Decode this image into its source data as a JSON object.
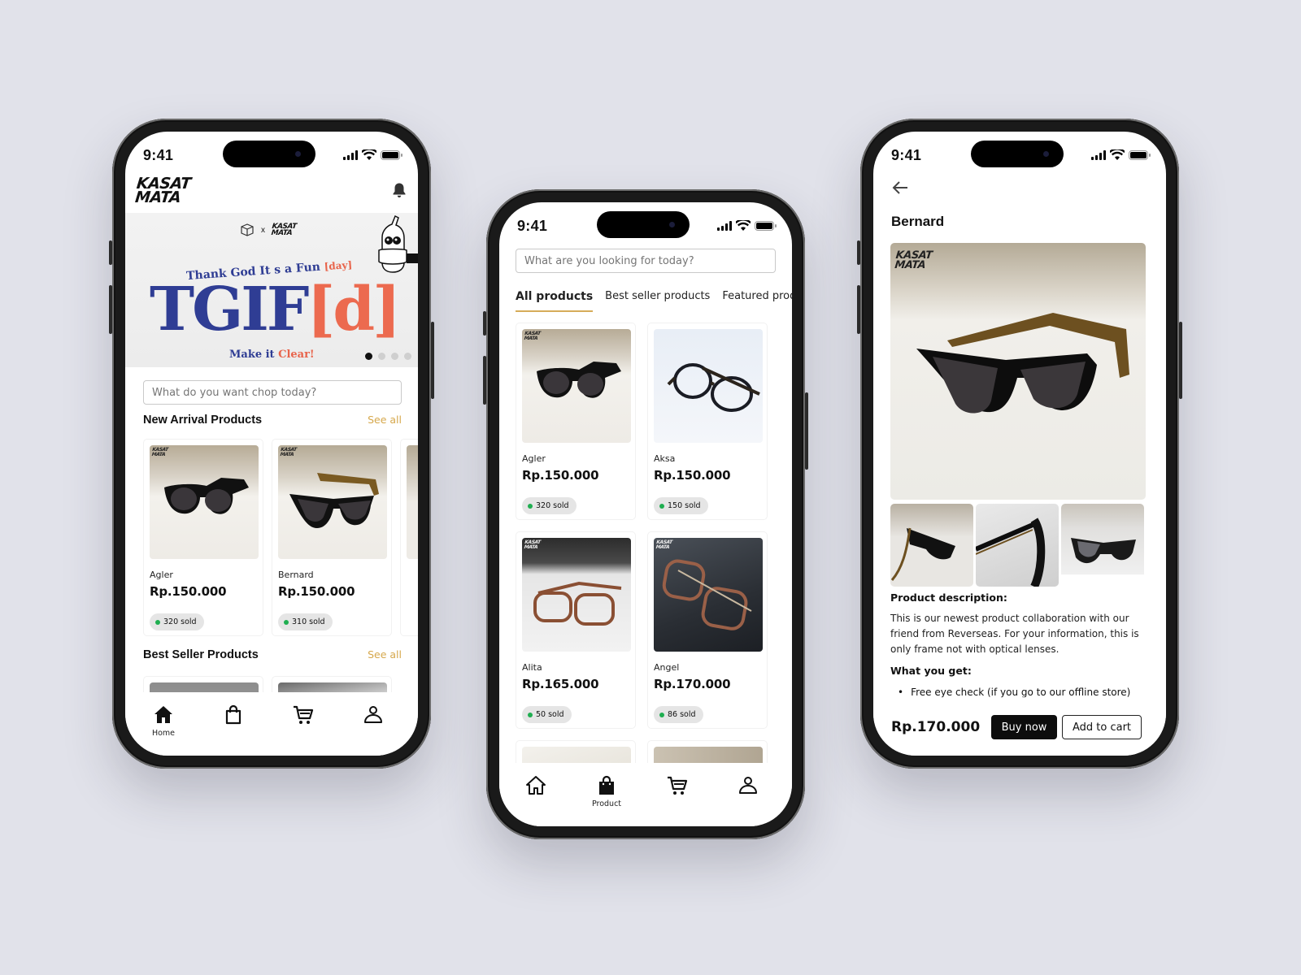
{
  "status_bar": {
    "time": "9:41"
  },
  "brand": {
    "logo_line1": "KASAT",
    "logo_line2": "MATA"
  },
  "colors": {
    "background": "#e1e2ea",
    "accent_gold": "#d6a84c",
    "banner_blue": "#2f3d94",
    "banner_coral": "#ec6a4f",
    "sold_dot": "#1fae50",
    "primary_button": "#0d0d0d"
  },
  "home": {
    "banner": {
      "collab_x": "x",
      "subtitle": "Thank God It s a Fun",
      "subtitle_accent": "[day]",
      "headline": "TGIF",
      "headline_accent": "[d]",
      "footer": "Make it",
      "footer_accent": "Clear!",
      "slide_count": 4,
      "active_slide": 1
    },
    "search_placeholder": "What do you want chop today?",
    "sections": [
      {
        "title": "New Arrival Products",
        "see_all": "See all",
        "products": [
          {
            "name": "Agler",
            "price": "Rp.150.000",
            "sold": "320 sold"
          },
          {
            "name": "Bernard",
            "price": "Rp.150.000",
            "sold": "310 sold"
          }
        ]
      },
      {
        "title": "Best Seller Products",
        "see_all": "See all"
      }
    ],
    "tabbar": [
      {
        "icon": "home-icon",
        "label": "Home",
        "active": true
      },
      {
        "icon": "shopping-bag-icon",
        "label": "",
        "active": false
      },
      {
        "icon": "cart-icon",
        "label": "",
        "active": false
      },
      {
        "icon": "profile-icon",
        "label": "",
        "active": false
      }
    ]
  },
  "products_page": {
    "search_placeholder": "What are you looking for today?",
    "tabs": [
      {
        "label": "All products",
        "active": true
      },
      {
        "label": "Best seller products",
        "active": false
      },
      {
        "label": "Featured products",
        "active": false
      }
    ],
    "products": [
      {
        "name": "Agler",
        "price": "Rp.150.000",
        "sold": "320 sold"
      },
      {
        "name": "Aksa",
        "price": "Rp.150.000",
        "sold": "150 sold"
      },
      {
        "name": "Alita",
        "price": "Rp.165.000",
        "sold": "50 sold"
      },
      {
        "name": "Angel",
        "price": "Rp.170.000",
        "sold": "86 sold"
      }
    ],
    "tabbar": [
      {
        "icon": "home-icon",
        "label": "",
        "active": false
      },
      {
        "icon": "shopping-bag-icon",
        "label": "Product",
        "active": true
      },
      {
        "icon": "cart-icon",
        "label": "",
        "active": false
      },
      {
        "icon": "profile-icon",
        "label": "",
        "active": false
      }
    ]
  },
  "detail_page": {
    "title": "Bernard",
    "description_label": "Product description:",
    "description": "This is our newest product collaboration with our friend from Reverseas. For your information, this is only frame not with optical lenses.",
    "what_you_get_label": "What you get:",
    "benefits": [
      "Free eye check (if you go to our offline store)"
    ],
    "price": "Rp.170.000",
    "buy_now": "Buy now",
    "add_to_cart": "Add to cart"
  }
}
